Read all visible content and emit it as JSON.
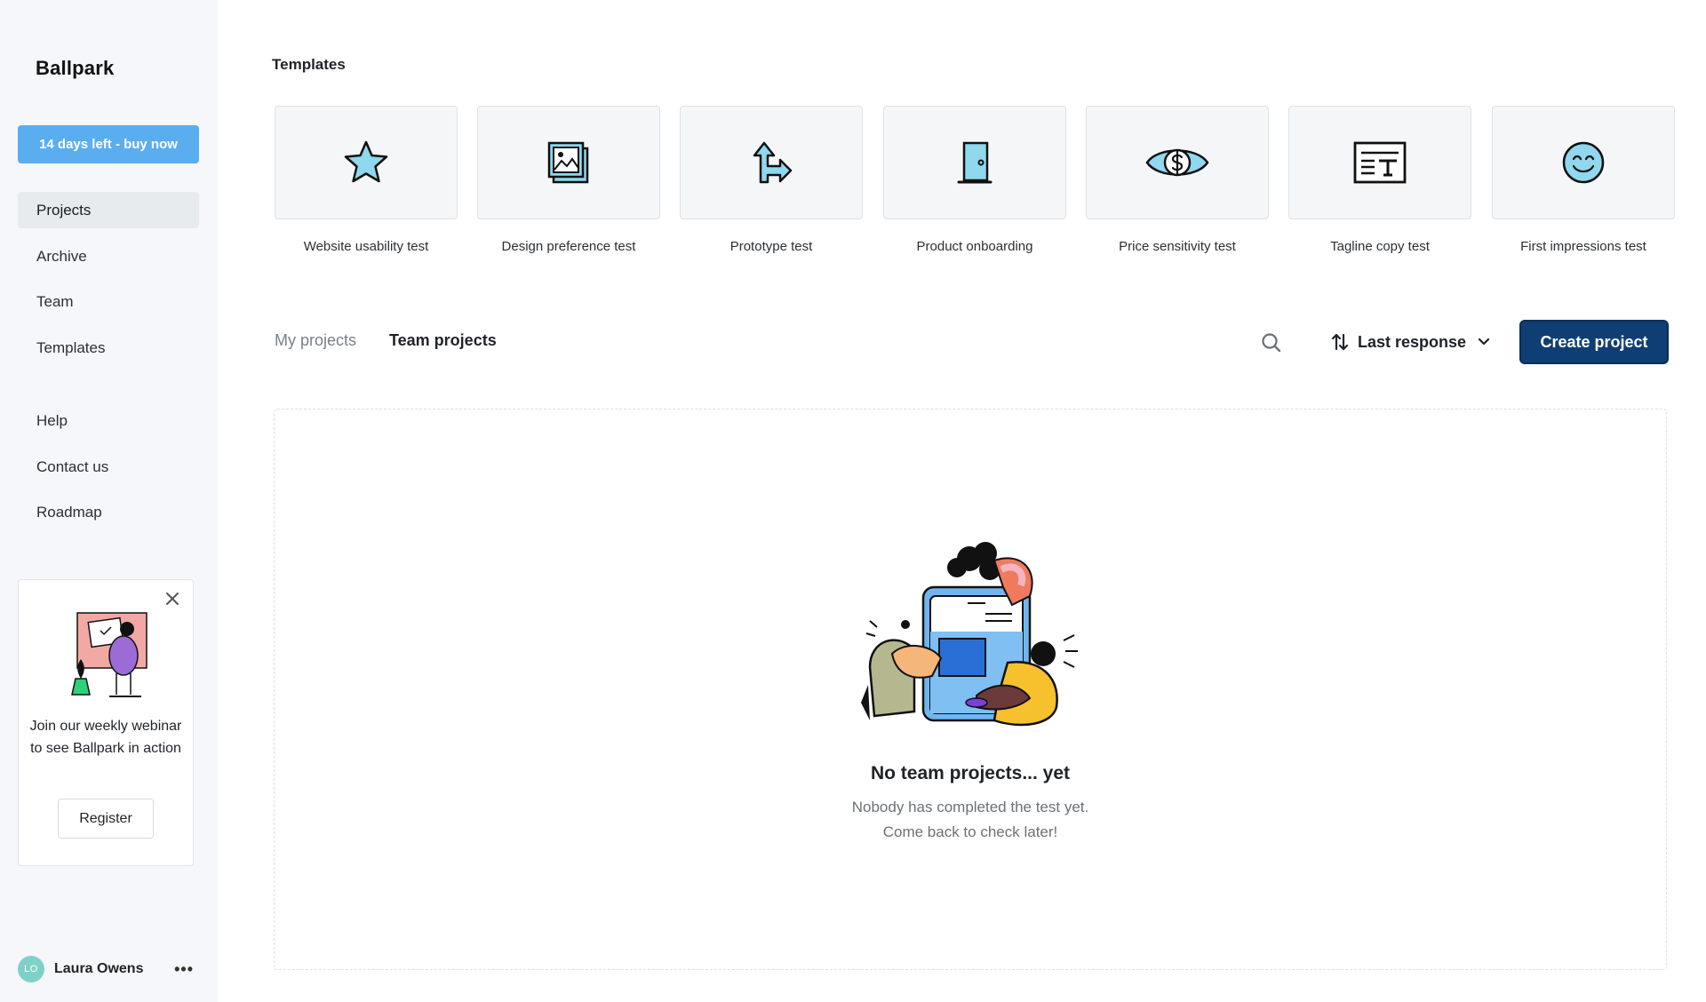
{
  "brand": {
    "name": "Ballpark"
  },
  "sidebar": {
    "trial_label": "14 days left - buy now",
    "nav": [
      {
        "label": "Projects",
        "active": true
      },
      {
        "label": "Archive",
        "active": false
      },
      {
        "label": "Team",
        "active": false
      },
      {
        "label": "Templates",
        "active": false
      }
    ],
    "secondary_nav": [
      {
        "label": "Help"
      },
      {
        "label": "Contact us"
      },
      {
        "label": "Roadmap"
      }
    ],
    "promo": {
      "text": "Join our weekly webinar to see Ballpark in action",
      "button_label": "Register",
      "close_icon": "close-icon"
    },
    "user": {
      "initials": "LO",
      "name": "Laura Owens",
      "menu_label": "•••"
    }
  },
  "templates": {
    "title": "Templates",
    "items": [
      {
        "label": "Website usability test",
        "icon": "star-icon"
      },
      {
        "label": "Design preference test",
        "icon": "image-icon"
      },
      {
        "label": "Prototype test",
        "icon": "arrow-turn-icon"
      },
      {
        "label": "Product onboarding",
        "icon": "door-icon"
      },
      {
        "label": "Price sensitivity test",
        "icon": "eye-dollar-icon"
      },
      {
        "label": "Tagline copy test",
        "icon": "text-box-icon"
      },
      {
        "label": "First impressions test",
        "icon": "smile-icon"
      }
    ]
  },
  "projects": {
    "tabs": [
      {
        "label": "My projects",
        "active": false
      },
      {
        "label": "Team projects",
        "active": true
      }
    ],
    "sort_label": "Last response",
    "create_label": "Create project",
    "empty": {
      "title": "No team projects... yet",
      "line1": "Nobody has completed the test yet.",
      "line2": "Come back to check later!"
    }
  },
  "colors": {
    "accent_blue": "#5aaef0",
    "primary_navy": "#0f3e74",
    "icon_fill": "#8fd8ee"
  }
}
